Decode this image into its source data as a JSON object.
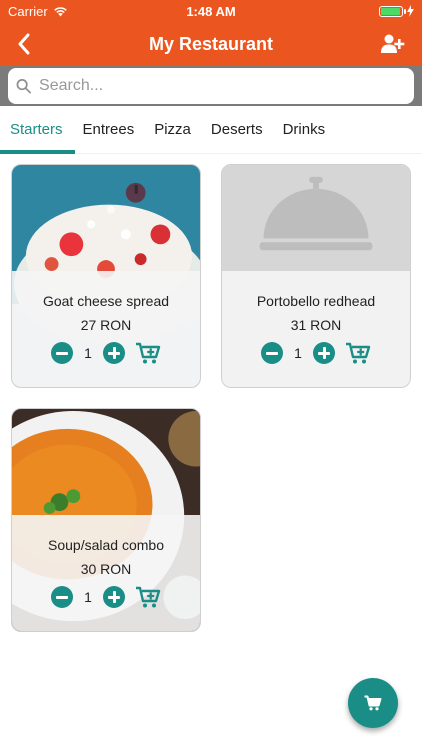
{
  "status": {
    "carrier": "Carrier",
    "time": "1:48 AM",
    "battery_level": 0.95
  },
  "nav": {
    "title": "My Restaurant"
  },
  "search": {
    "placeholder": "Search..."
  },
  "tabs": [
    {
      "label": "Starters",
      "active": true
    },
    {
      "label": "Entrees"
    },
    {
      "label": "Pizza"
    },
    {
      "label": "Deserts"
    },
    {
      "label": "Drinks"
    }
  ],
  "items": [
    {
      "name": "Goat cheese spread",
      "price": "27",
      "currency": "RON",
      "qty": "1"
    },
    {
      "name": "Portobello redhead",
      "price": "31",
      "currency": "RON",
      "qty": "1"
    },
    {
      "name": "Soup/salad combo",
      "price": "30",
      "currency": "RON",
      "qty": "1"
    }
  ],
  "colors": {
    "header": "#ea5520",
    "accent": "#1a8e86",
    "search_bg": "#7b7b7b"
  }
}
